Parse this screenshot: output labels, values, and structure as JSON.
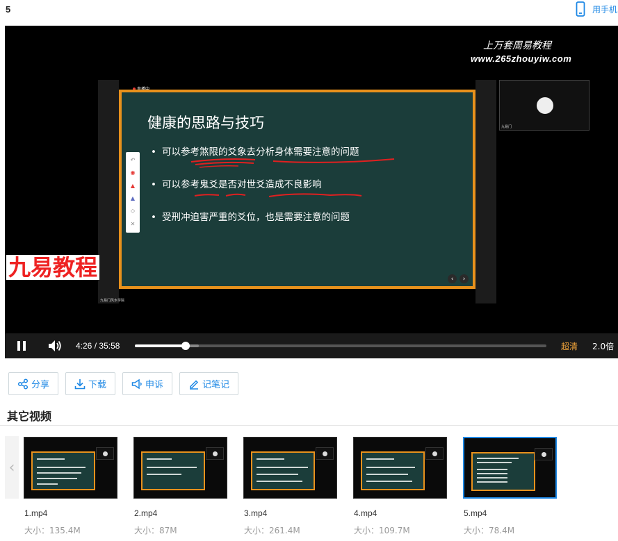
{
  "header": {
    "title": "5",
    "mobile_label": "用手机"
  },
  "player": {
    "watermark_title": "上万套周易教程",
    "watermark_url": "www.265zhouyiw.com",
    "presenter_tag": "直播中",
    "slide": {
      "title": "健康的思路与技巧",
      "bullets": [
        "可以参考煞限的爻象去分析身体需要注意的问题",
        "可以参考鬼爻是否对世爻造成不良影响",
        "受刑冲迫害严重的爻位，也是需要注意的问题"
      ]
    },
    "brand_logo": "九易教程",
    "camera_name": "九易门",
    "bottom_caption": "九易门风水学院",
    "annotation_color": "#e02020",
    "board_border_color": "#e8911c",
    "board_bg_color": "#1b3d3a"
  },
  "controls": {
    "current_time": "4:26",
    "separator": "/",
    "duration": "35:58",
    "progress_fraction": 0.1237,
    "quality_label": "超清",
    "speed_label": "2.0倍",
    "quality_color": "#f2a43a"
  },
  "actions": {
    "share": "分享",
    "download": "下载",
    "report": "申诉",
    "note": "记笔记",
    "accent_color": "#1e88e5"
  },
  "related": {
    "title": "其它视频",
    "size_prefix": "大小：",
    "items": [
      {
        "name": "1.mp4",
        "size": "大小：135.4M",
        "active": false
      },
      {
        "name": "2.mp4",
        "size": "大小：87M",
        "active": false
      },
      {
        "name": "3.mp4",
        "size": "大小：261.4M",
        "active": false
      },
      {
        "name": "4.mp4",
        "size": "大小：109.7M",
        "active": false
      },
      {
        "name": "5.mp4",
        "size": "大小：78.4M",
        "active": true
      }
    ]
  }
}
